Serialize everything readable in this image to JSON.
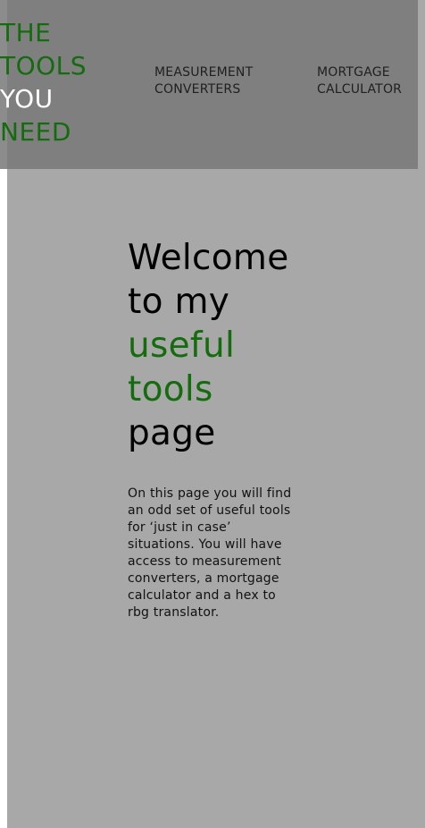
{
  "header": {
    "logo_lines": [
      "THE",
      "TOOLS",
      "YOU",
      "NEED"
    ],
    "nav": [
      {
        "line1": "MEASUREMENT",
        "line2": "CONVERTERS"
      },
      {
        "line1": "MORTGAGE",
        "line2": "CALCULATOR"
      }
    ]
  },
  "hero": {
    "title_lines": [
      "Welcome",
      "to my",
      "useful",
      "tools",
      "page"
    ],
    "intro": "On this page you will find an odd set of useful tools for ‘just in case’ situations. You will have access to measurement converters, a mortgage calculator and a hex to rbg translator."
  },
  "colors": {
    "accent": "#146c0e",
    "header_bg": "#7d7d7d",
    "page_bg": "#a8a8a8"
  }
}
